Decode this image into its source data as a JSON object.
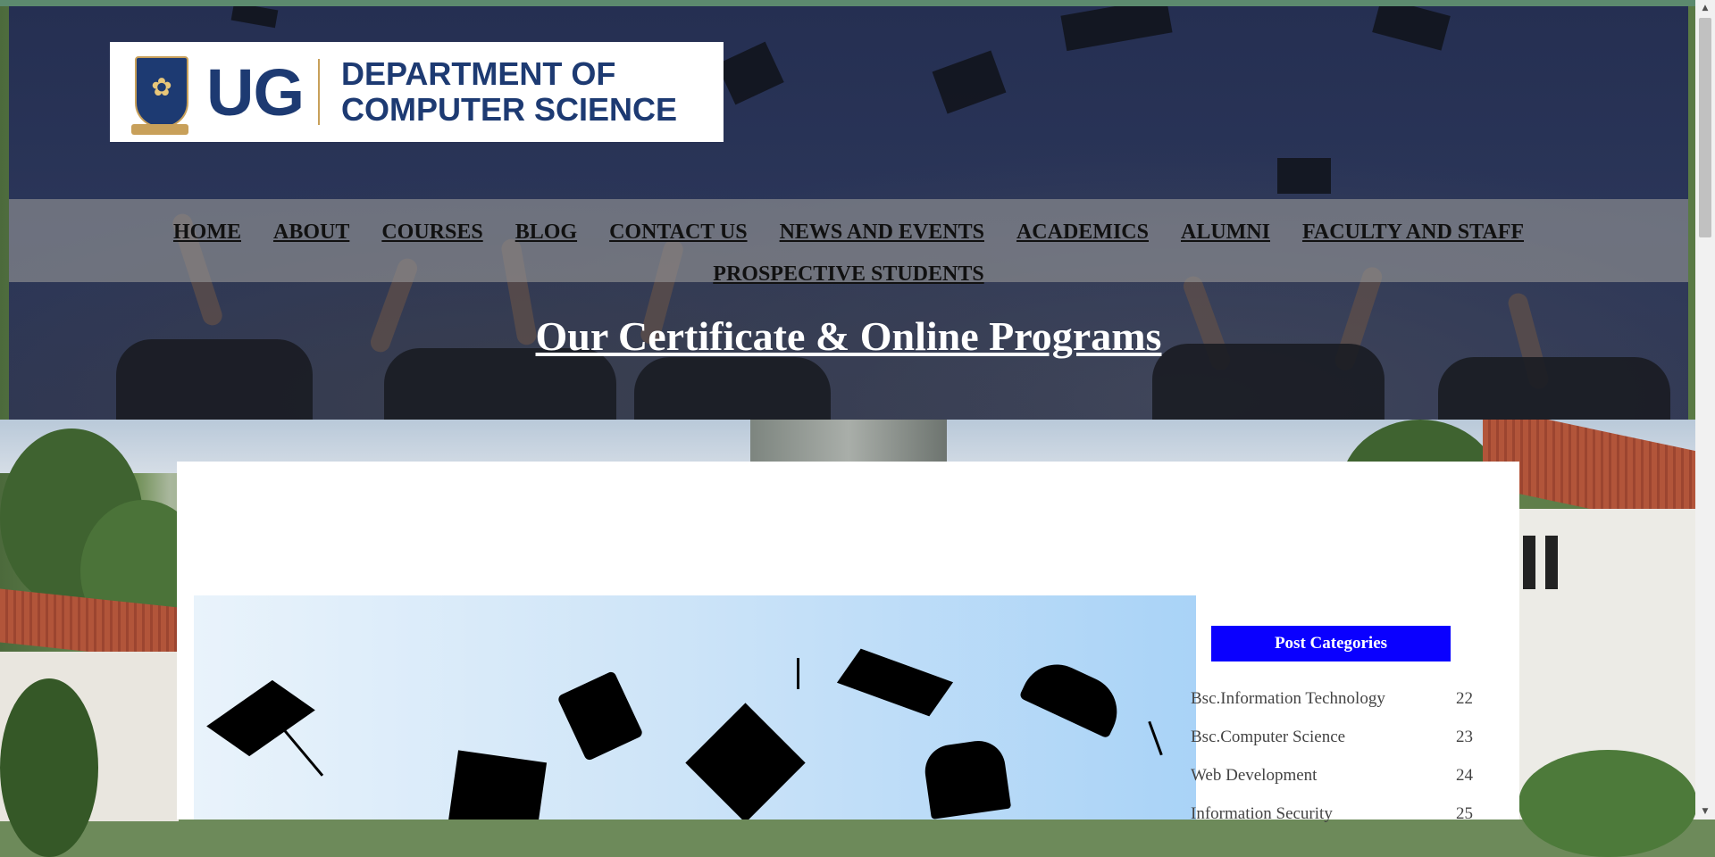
{
  "header": {
    "logo": {
      "ug_text": "UG",
      "dept_line1": "DEPARTMENT OF",
      "dept_line2": "COMPUTER SCIENCE"
    }
  },
  "nav": {
    "items": [
      {
        "label": "HOME"
      },
      {
        "label": "ABOUT"
      },
      {
        "label": "COURSES"
      },
      {
        "label": "BLOG"
      },
      {
        "label": "CONTACT US"
      },
      {
        "label": "NEWS AND EVENTS"
      },
      {
        "label": "ACADEMICS"
      },
      {
        "label": "ALUMNI"
      },
      {
        "label": "FACULTY AND STAFF"
      },
      {
        "label": "PROSPECTIVE STUDENTS"
      }
    ]
  },
  "hero": {
    "title": "Our Certificate & Online Programs"
  },
  "sidebar": {
    "header": "Post Categories",
    "categories": [
      {
        "name": "Bsc.Information Technology",
        "count": "22"
      },
      {
        "name": "Bsc.Computer Science",
        "count": "23"
      },
      {
        "name": "Web Development",
        "count": "24"
      },
      {
        "name": "Information Security",
        "count": "25"
      }
    ]
  },
  "colors": {
    "accent_blue": "#0a00ff",
    "brand_navy": "#1d3a72",
    "brand_gold": "#c8a05a"
  }
}
